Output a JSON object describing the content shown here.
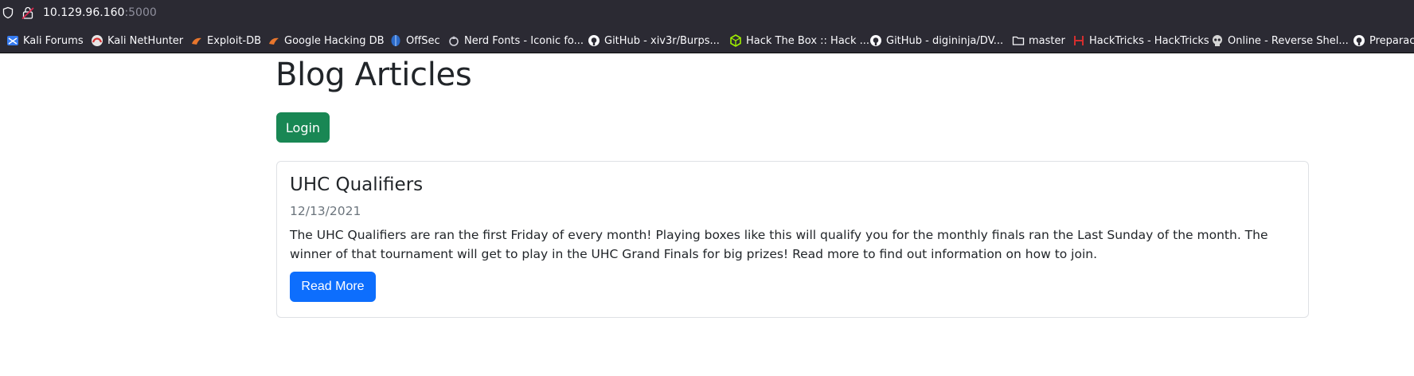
{
  "browser": {
    "url_host": "10.129.96.160",
    "url_port": ":5000",
    "bookmarks": [
      {
        "label": "Kali Forums",
        "icon": "kali-forums-icon"
      },
      {
        "label": "Kali NetHunter",
        "icon": "kali-nethunter-icon"
      },
      {
        "label": "Exploit-DB",
        "icon": "exploit-db-icon"
      },
      {
        "label": "Google Hacking DB",
        "icon": "google-hacking-db-icon"
      },
      {
        "label": "OffSec",
        "icon": "offsec-icon"
      },
      {
        "label": "Nerd Fonts - Iconic fo...",
        "icon": "nerd-fonts-icon"
      },
      {
        "label": "GitHub - xiv3r/Burps...",
        "icon": "github-icon"
      },
      {
        "label": "Hack The Box :: Hack ...",
        "icon": "hack-the-box-icon"
      },
      {
        "label": "GitHub - digininja/DV...",
        "icon": "github-icon"
      },
      {
        "label": "master",
        "icon": "folder-icon"
      },
      {
        "label": "HackTricks - HackTricks",
        "icon": "hacktricks-icon"
      },
      {
        "label": "Online - Reverse Shel...",
        "icon": "skull-icon"
      },
      {
        "label": "Preparac",
        "icon": "github-icon"
      }
    ]
  },
  "page": {
    "title": "Blog Articles",
    "login_label": "Login",
    "articles": [
      {
        "title": "UHC Qualifiers",
        "date": "12/13/2021",
        "body": "The UHC Qualifiers are ran the first Friday of every month! Playing boxes like this will qualify you for the monthly finals ran the Last Sunday of the month. The winner of that tournament will get to play in the UHC Grand Finals for big prizes! Read more to find out information on how to join.",
        "button_label": "Read More"
      }
    ]
  },
  "colors": {
    "browser_chrome": "#2b2a33",
    "login_button": "#198754",
    "read_more_button": "#0d6efd",
    "date_text": "#6c757d"
  }
}
